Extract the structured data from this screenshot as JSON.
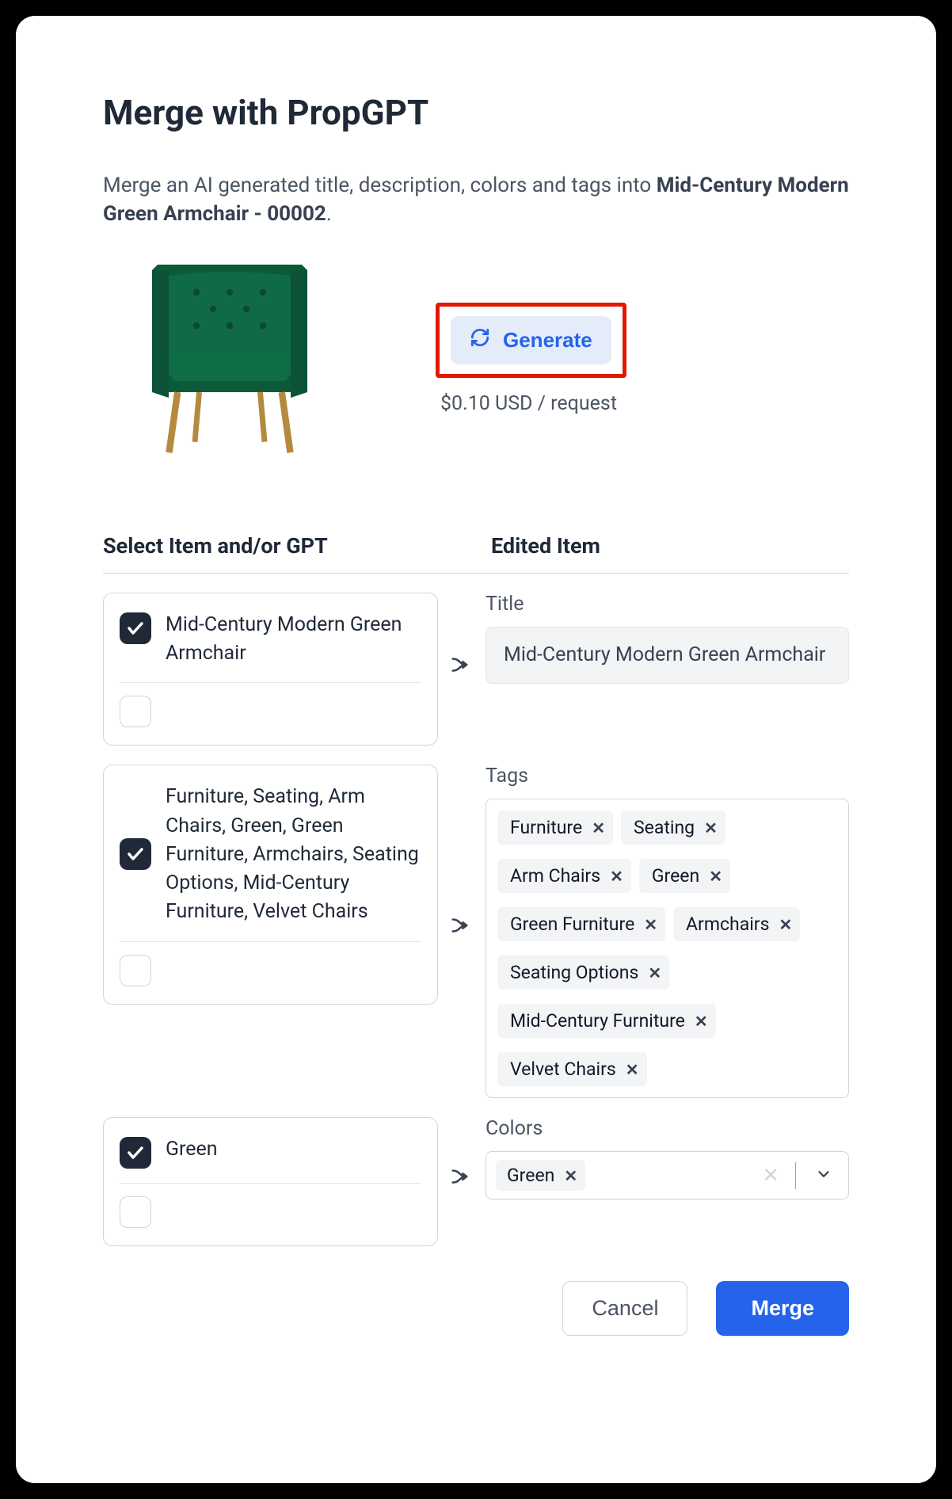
{
  "modal": {
    "title": "Merge with PropGPT",
    "subtitle_prefix": "Merge an AI generated title, description, colors and tags into ",
    "subtitle_item": "Mid-Century Modern Green Armchair - 00002",
    "subtitle_suffix": "."
  },
  "generate": {
    "button_label": "Generate",
    "price_text": "$0.10 USD / request"
  },
  "columns": {
    "left_heading": "Select Item and/or GPT",
    "right_heading": "Edited Item"
  },
  "title_row": {
    "source_item_checked": true,
    "source_item_text": "Mid-Century Modern Green Armchair",
    "source_gpt_checked": false,
    "source_gpt_text": "",
    "field_label": "Title",
    "value": "Mid-Century Modern Green Armchair"
  },
  "tags_row": {
    "source_item_checked": true,
    "source_item_text": "Furniture, Seating, Arm Chairs, Green, Green Furniture, Armchairs, Seating Options, Mid-Century Furniture, Velvet Chairs",
    "source_gpt_checked": false,
    "source_gpt_text": "",
    "field_label": "Tags",
    "tags": [
      "Furniture",
      "Seating",
      "Arm Chairs",
      "Green",
      "Green Furniture",
      "Armchairs",
      "Seating Options",
      "Mid-Century Furniture",
      "Velvet Chairs"
    ]
  },
  "colors_row": {
    "source_item_checked": true,
    "source_item_text": "Green",
    "source_gpt_checked": false,
    "source_gpt_text": "",
    "field_label": "Colors",
    "colors": [
      "Green"
    ]
  },
  "footer": {
    "cancel_label": "Cancel",
    "merge_label": "Merge"
  }
}
